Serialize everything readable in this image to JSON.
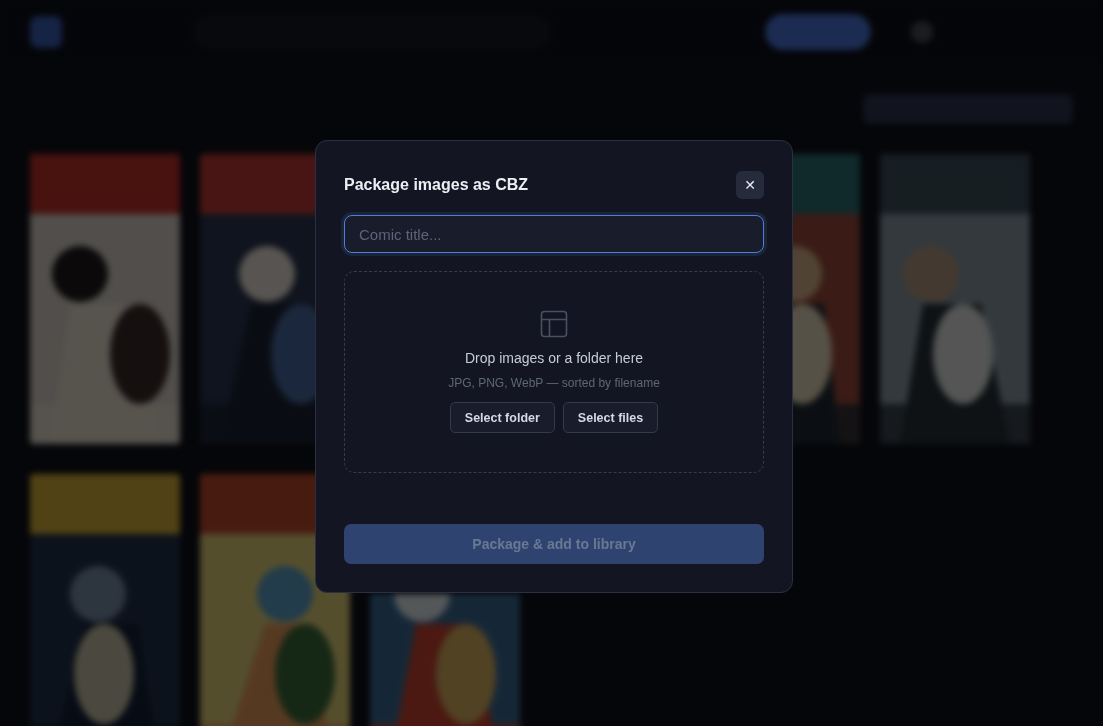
{
  "dialog": {
    "title": "Package images as CBZ",
    "close_label": "✕",
    "title_field": {
      "placeholder": "Comic title..."
    },
    "dropzone": {
      "heading": "Drop images or a folder here",
      "hint": "JPG, PNG, WebP — sorted by filename",
      "buttons": [
        "Select folder",
        "Select files"
      ]
    },
    "submit": {
      "label": "Package & add to library",
      "disabled": true
    }
  }
}
